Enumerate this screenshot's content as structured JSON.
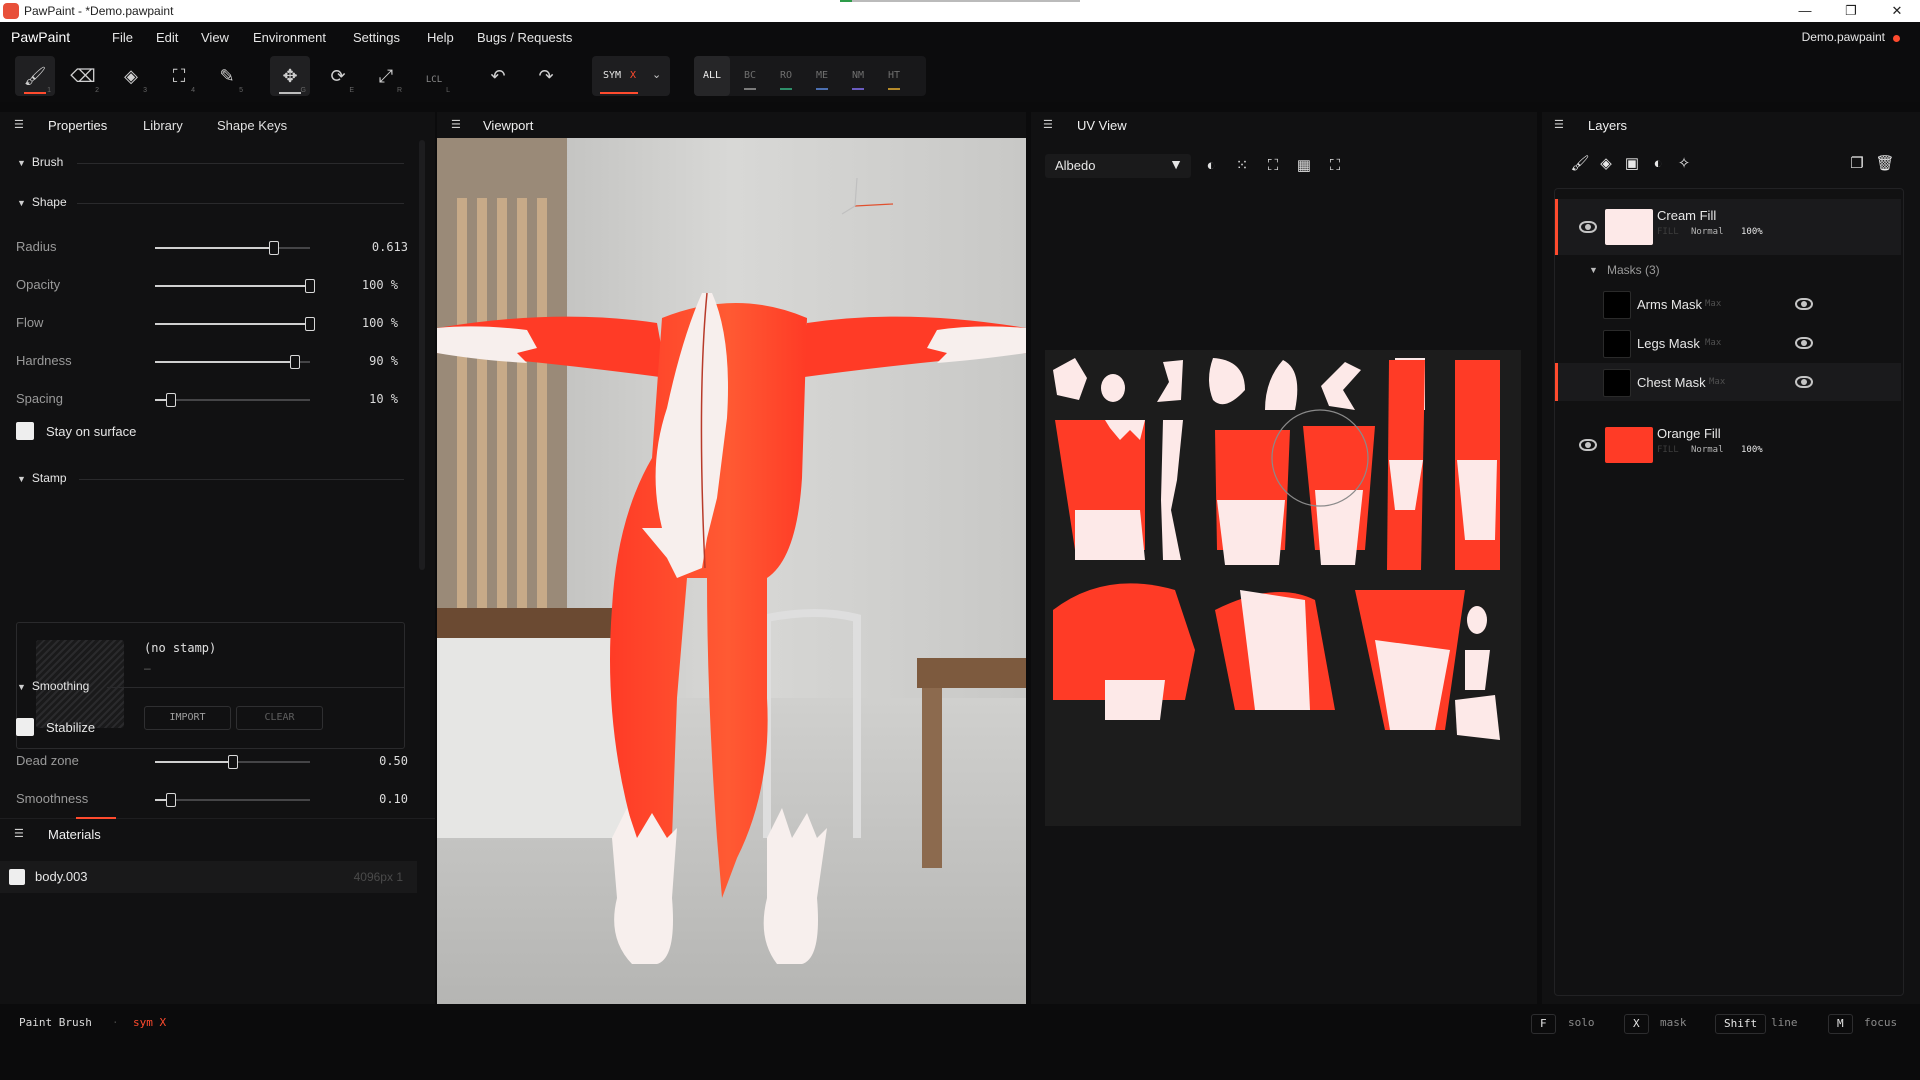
{
  "window": {
    "title": "PawPaint - *Demo.pawpaint",
    "progress_fraction": 0.05,
    "buttons": [
      "—",
      "❐",
      "✕"
    ]
  },
  "menubar": {
    "brand": "PawPaint",
    "menus": [
      "File",
      "Edit",
      "View",
      "Environment",
      "Settings",
      "Help",
      "Bugs / Requests"
    ],
    "document": "Demo.pawpaint",
    "unsaved_color": "#ff4b2e"
  },
  "toolbar": {
    "tools": [
      {
        "icon": "paint-brush-icon",
        "glyph": "🖌",
        "key": "1",
        "active": true
      },
      {
        "icon": "eraser-icon",
        "glyph": "⌫",
        "key": "2"
      },
      {
        "icon": "paint-bucket-icon",
        "glyph": "◈",
        "key": "3"
      },
      {
        "icon": "crop-icon",
        "glyph": "⛶",
        "key": "4"
      },
      {
        "icon": "eyedropper-icon",
        "glyph": "✎",
        "key": "5"
      }
    ],
    "transform_tools": [
      {
        "icon": "move-icon",
        "glyph": "✥",
        "key": "G",
        "active": true
      },
      {
        "icon": "rotate-icon",
        "glyph": "⟳",
        "key": "E"
      },
      {
        "icon": "scale-icon",
        "glyph": "⤢",
        "key": "R"
      },
      {
        "label": "LCL",
        "key": "L"
      }
    ],
    "undo_icon": "undo-icon",
    "redo_icon": "redo-icon",
    "sym_label": "SYM",
    "sym_axis": "X",
    "channels": [
      {
        "label": "ALL",
        "active": true,
        "color": ""
      },
      {
        "label": "BC",
        "color": "#7a7a7a"
      },
      {
        "label": "RO",
        "color": "#2e8f6a"
      },
      {
        "label": "ME",
        "color": "#4c6fb0"
      },
      {
        "label": "NM",
        "color": "#6a5cc0"
      },
      {
        "label": "HT",
        "color": "#b58a2a"
      }
    ]
  },
  "left_panel": {
    "tabs": [
      "Properties",
      "Library",
      "Shape Keys"
    ],
    "brush_title": "Brush",
    "shape_title": "Shape",
    "shape_params": [
      {
        "label": "Radius",
        "value": "0.613",
        "level": 0.77
      },
      {
        "label": "Opacity",
        "value": "100 %",
        "level": 1.0
      },
      {
        "label": "Flow",
        "value": "100 %",
        "level": 1.0
      },
      {
        "label": "Hardness",
        "value": "90 %",
        "level": 0.9
      },
      {
        "label": "Spacing",
        "value": "10 %",
        "level": 0.1
      }
    ],
    "stay_on_surface": "Stay on surface",
    "stamp_title": "Stamp",
    "stamp_none": "(no stamp)",
    "stamp_dash": "–",
    "import_label": "IMPORT",
    "clear_label": "CLEAR",
    "smoothing_title": "Smoothing",
    "stabilize": "Stabilize",
    "smoothing_params": [
      {
        "label": "Dead zone",
        "value": "0.50",
        "level": 0.5
      },
      {
        "label": "Smoothness",
        "value": "0.10",
        "level": 0.1
      }
    ],
    "materials_title": "Materials",
    "material": {
      "name": "body.003",
      "size": "4096px",
      "count": "1"
    }
  },
  "viewport": {
    "title": "Viewport"
  },
  "uv_view": {
    "title": "UV View",
    "channel": "Albedo",
    "tool_icons": [
      "contrast-icon",
      "grid-icon",
      "crop-icon",
      "checker-icon",
      "fullscreen-icon"
    ]
  },
  "layers": {
    "title": "Layers",
    "tool_icons": [
      "brush-icon",
      "fill-icon",
      "folder-add-icon",
      "adjust-icon",
      "magic-wand-icon"
    ],
    "right_icons": [
      "duplicate-icon",
      "trash-icon"
    ],
    "items": [
      {
        "name": "Cream Fill",
        "type": "FILL",
        "blend": "Normal",
        "opacity": "100%",
        "color": "#fde9e8",
        "selected": true
      },
      {
        "name": "Orange Fill",
        "type": "FILL",
        "blend": "Normal",
        "opacity": "100%",
        "color": "#ff3b26"
      }
    ],
    "masks_title": "Masks (3)",
    "masks": [
      {
        "name": "Arms Mask",
        "mode": "Max"
      },
      {
        "name": "Legs Mask",
        "mode": "Max"
      },
      {
        "name": "Chest Mask",
        "mode": "Max",
        "selected": true
      }
    ]
  },
  "status": {
    "tool": "Paint Brush",
    "sep": "·",
    "sym": "sym X",
    "hints": [
      {
        "key": "F",
        "desc": "solo"
      },
      {
        "key": "X",
        "desc": "mask"
      },
      {
        "key": "Shift",
        "desc": "line"
      },
      {
        "key": "M",
        "desc": "focus"
      }
    ]
  },
  "colors": {
    "accent": "#ff4b2e",
    "orange": "#ff3b26",
    "cream": "#fde9e8"
  }
}
